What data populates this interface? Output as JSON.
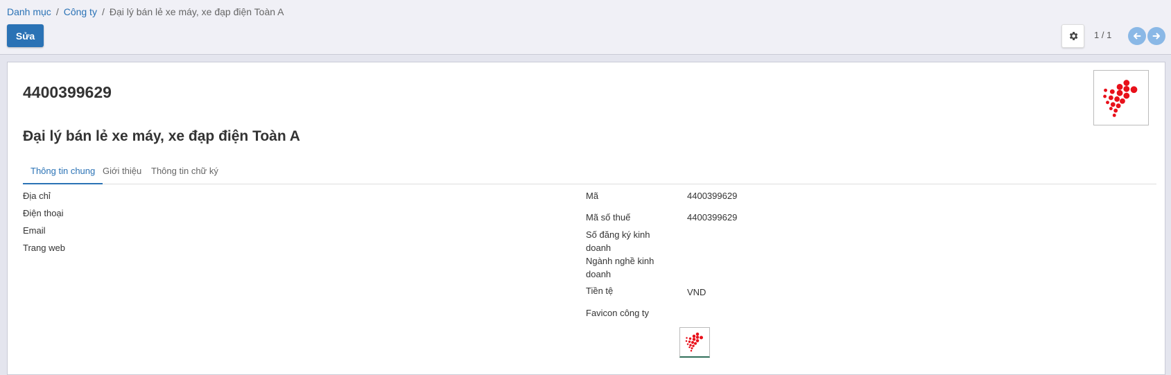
{
  "breadcrumb": {
    "item1": "Danh mục",
    "item2": "Công ty",
    "separator": "/",
    "current": "Đại lý bán lẻ xe máy, xe đạp điện Toàn A"
  },
  "toolbar": {
    "edit_label": "Sửa",
    "pager_value": "1 / 1"
  },
  "record": {
    "code": "4400399629",
    "name": "Đại lý bán lẻ xe máy, xe đạp điện Toàn A"
  },
  "tabs": [
    {
      "label": "Thông tin chung",
      "active": true
    },
    {
      "label": "Giới thiệu",
      "active": false
    },
    {
      "label": "Thông tin chữ ký",
      "active": false
    }
  ],
  "left_fields": [
    {
      "label": "Địa chỉ",
      "value": ""
    },
    {
      "label": "Điện thoại",
      "value": ""
    },
    {
      "label": "Email",
      "value": ""
    },
    {
      "label": "Trang web",
      "value": ""
    }
  ],
  "right_fields": {
    "code": {
      "label": "Mã",
      "value": "4400399629"
    },
    "tax": {
      "label": "Mã số thuế",
      "value": "4400399629"
    },
    "business_reg": {
      "label_line1": "Số đăng ký kinh",
      "label_line2": "doanh",
      "value": ""
    },
    "industry": {
      "label_line1": "Ngành nghề kinh",
      "label_line2": "doanh",
      "value": ""
    },
    "currency": {
      "label": "Tiền tệ",
      "value": "VND"
    },
    "favicon": {
      "label": "Favicon công ty"
    }
  },
  "colors": {
    "primary": "#2a72b5",
    "logo_red": "#e8101a",
    "control_bg": "#f0f0f6",
    "page_bg": "#e4e5ee"
  },
  "icons": {
    "settings": "gear-icon",
    "prev": "arrow-left-icon",
    "next": "arrow-right-icon",
    "logo": "company-logo-dots"
  }
}
